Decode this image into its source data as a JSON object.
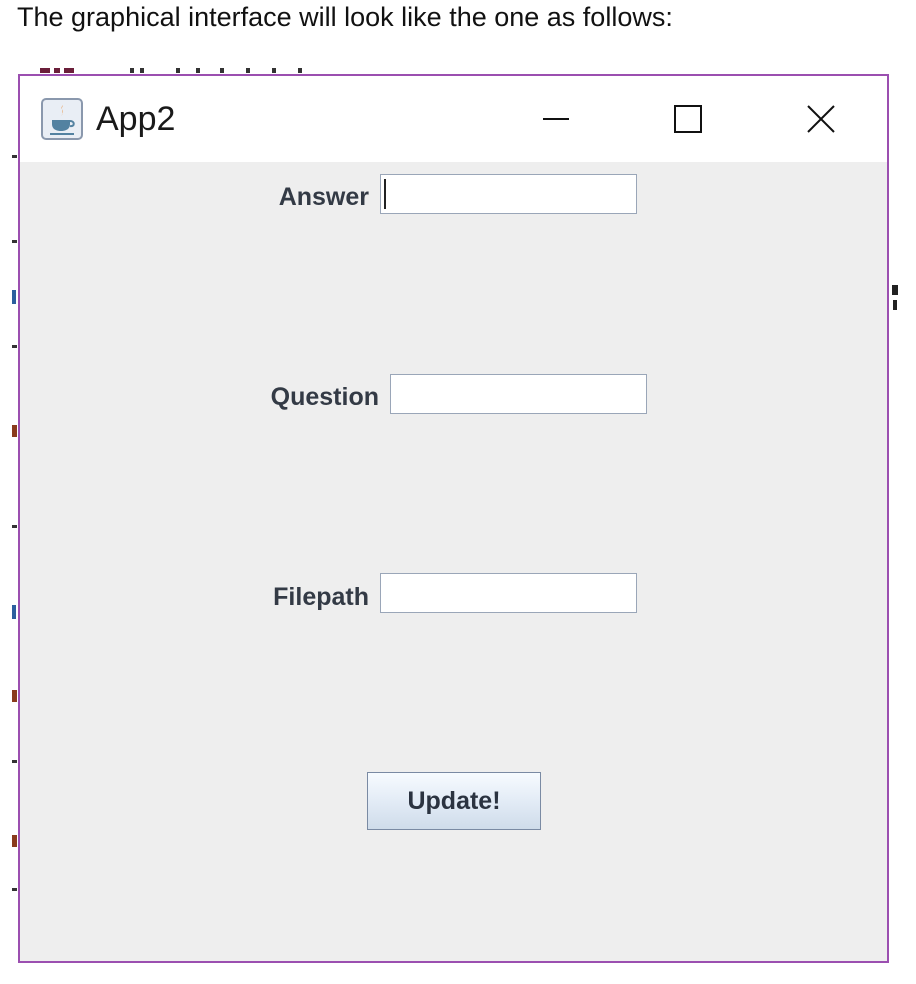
{
  "caption": "The graphical interface will look like the one as follows:",
  "window": {
    "title": "App2",
    "icon": "java-cup-icon",
    "controls": {
      "minimize": "minimize-icon",
      "maximize": "maximize-icon",
      "close": "close-icon"
    }
  },
  "form": {
    "answer_label": "Answer",
    "answer_value": "",
    "question_label": "Question",
    "question_value": "",
    "filepath_label": "Filepath",
    "filepath_value": "",
    "update_label": "Update!"
  },
  "colors": {
    "window_border": "#9b4fb0",
    "content_bg": "#eeeeee",
    "titlebar_bg": "#ffffff",
    "label_text": "#333a45",
    "java_orange": "#e76f00",
    "java_blue": "#5382a1"
  }
}
